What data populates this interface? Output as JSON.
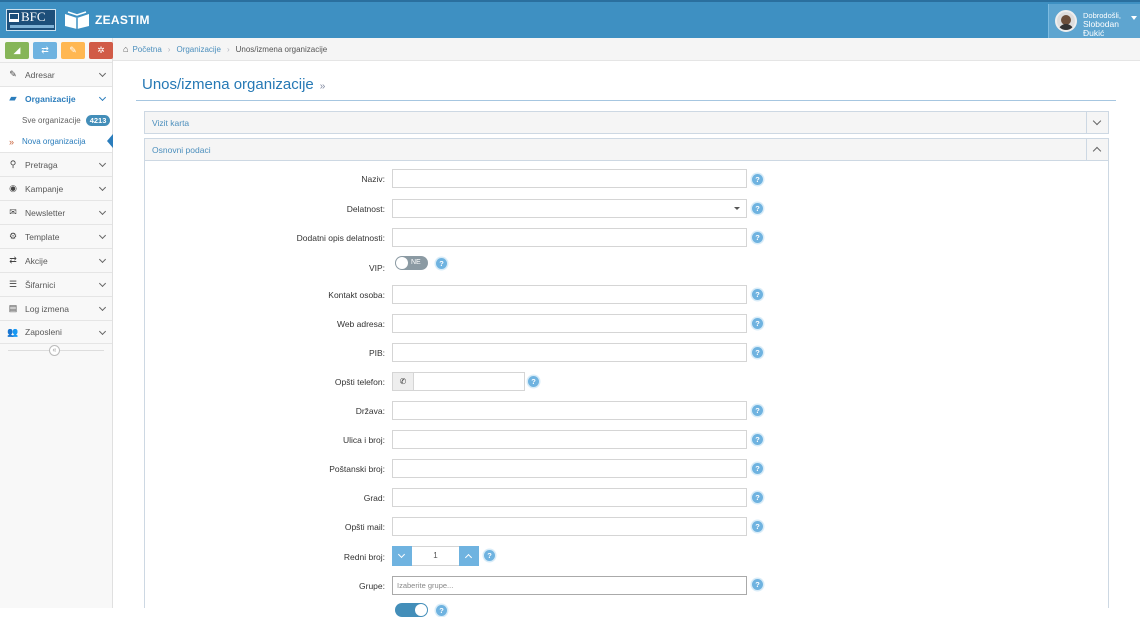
{
  "brand": {
    "bfc": "BFC",
    "app": "ZEASTIM"
  },
  "user": {
    "greeting": "Dobrodošli,",
    "first": "Slobodan",
    "last": "Đukić"
  },
  "shortcuts": [
    {
      "icon": "chart-icon",
      "glyph": "◢"
    },
    {
      "icon": "exchange-icon",
      "glyph": "⇄"
    },
    {
      "icon": "pencil-icon",
      "glyph": "✎"
    },
    {
      "icon": "cog-icon",
      "glyph": "✲"
    }
  ],
  "sidebar": {
    "items": [
      {
        "label": "Adresar",
        "icon": "edit-icon",
        "glyph": "✎"
      },
      {
        "label": "Organizacije",
        "icon": "briefcase-icon",
        "glyph": "▰"
      },
      {
        "label": "Pretraga",
        "icon": "search-icon",
        "glyph": "⚲"
      },
      {
        "label": "Kampanje",
        "icon": "bullseye-icon",
        "glyph": "◉"
      },
      {
        "label": "Newsletter",
        "icon": "envelope-icon",
        "glyph": "✉"
      },
      {
        "label": "Template",
        "icon": "cogs-icon",
        "glyph": "⚙"
      },
      {
        "label": "Akcije",
        "icon": "exchange-icon",
        "glyph": "⇄"
      },
      {
        "label": "Šifarnici",
        "icon": "list-icon",
        "glyph": "☰"
      },
      {
        "label": "Log izmena",
        "icon": "archive-icon",
        "glyph": "▤"
      },
      {
        "label": "Zaposleni",
        "icon": "users-icon",
        "glyph": "👥"
      }
    ],
    "sub": [
      {
        "label": "Sve organizacije",
        "badge": "4213"
      },
      {
        "label": "Nova organizacija"
      }
    ],
    "collapse": "«"
  },
  "breadcrumbs": {
    "home": "Početna",
    "section": "Organizacije",
    "current": "Unos/izmena organizacije"
  },
  "page": {
    "title": "Unos/izmena organizacije",
    "raquo": "»"
  },
  "panels": {
    "vizit": "Vizit karta",
    "osnovni": "Osnovni podaci"
  },
  "form": {
    "naziv": "Naziv:",
    "delatnost": "Delatnost:",
    "dodatni": "Dodatni opis delatnosti:",
    "vip": "VIP:",
    "vip_value": "NE",
    "kontakt": "Kontakt osoba:",
    "web": "Web adresa:",
    "pib": "PIB:",
    "telefon": "Opšti telefon:",
    "drzava": "Država:",
    "ulica": "Ulica i broj:",
    "postanski": "Poštanski broj:",
    "grad": "Grad:",
    "mail": "Opšti mail:",
    "redni": "Redni broj:",
    "redni_value": "1",
    "grupe": "Grupe:",
    "grupe_placeholder": "Izaberite grupe...",
    "help": "?"
  },
  "colors": {
    "topbar": "#3e90c2",
    "accent": "#438eb9",
    "active": "#2b7dbc"
  }
}
